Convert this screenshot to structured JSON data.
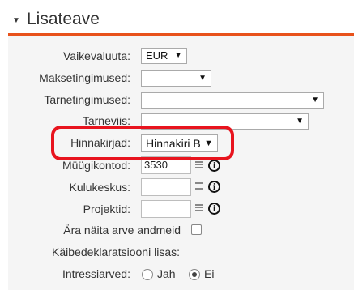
{
  "section": {
    "title": "Lisateave",
    "toggle_icon": "caret-down-icon",
    "accent_color": "#e8521b",
    "highlight_color": "#e8141e"
  },
  "fields": {
    "currency": {
      "label": "Vaikevaluuta:",
      "value": "EUR"
    },
    "payment_terms": {
      "label": "Maksetingimused:",
      "value": ""
    },
    "delivery_terms": {
      "label": "Tarnetingimused:",
      "value": ""
    },
    "delivery_method": {
      "label": "Tarneviis:",
      "value": ""
    },
    "price_list": {
      "label": "Hinnakirjad:",
      "value": "Hinnakiri B"
    },
    "sales_accounts": {
      "label": "Müügikontod:",
      "value": "3530"
    },
    "cost_centers": {
      "label": "Kulukeskus:",
      "value": ""
    },
    "projects": {
      "label": "Projektid:",
      "value": ""
    },
    "hide_invoice_data": {
      "label": "Ära näita arve andmeid",
      "checked": false
    },
    "vat_declaration": {
      "label": "Käibedeklaratsiooni lisas:"
    },
    "interest": {
      "label": "Intressiarved:",
      "options": [
        "Jah",
        "Ei"
      ],
      "selected": "Ei"
    }
  },
  "icons": {
    "info": "i"
  }
}
